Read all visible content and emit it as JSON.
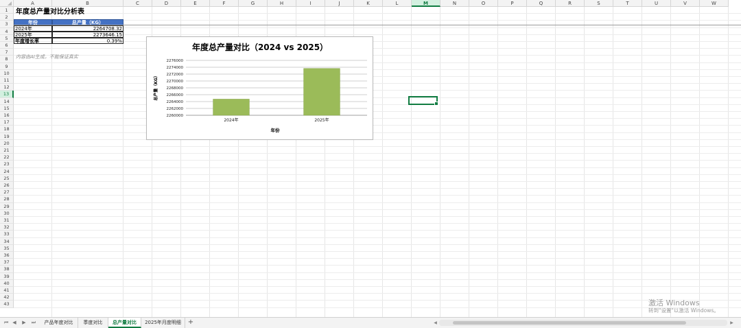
{
  "columns": [
    "A",
    "B",
    "C",
    "D",
    "E",
    "F",
    "G",
    "H",
    "I",
    "J",
    "K",
    "L",
    "M",
    "N",
    "O",
    "P",
    "Q",
    "R",
    "S",
    "T",
    "U",
    "V",
    "W"
  ],
  "active_column": "M",
  "active_row": 13,
  "row_count": 43,
  "cells": {
    "title": "年度总产量对比分析表",
    "header_year": "年份",
    "header_output": "总产量（KG）",
    "year_2024": "2024年",
    "value_2024": "2264708.32",
    "year_2025": "2025年",
    "value_2025": "2273646.15",
    "growth_label": "年度增长率",
    "growth_value": "0.39%",
    "ai_note": "内容由AI生成，不能保证真实"
  },
  "chart_data": {
    "type": "bar",
    "title": "年度总产量对比（2024 vs 2025）",
    "categories": [
      "2024年",
      "2025年"
    ],
    "values": [
      2264708.32,
      2273646.15
    ],
    "xlabel": "年份",
    "ylabel": "总产量（KG）",
    "ylim": [
      2260000,
      2276000
    ],
    "yticks": [
      2276000,
      2274000,
      2272000,
      2270000,
      2268000,
      2266000,
      2264000,
      2262000,
      2260000
    ],
    "grid": true,
    "legend": "none",
    "bar_color": "#9bbb59"
  },
  "tabs": [
    {
      "label": "产品年度对比",
      "active": false
    },
    {
      "label": "季度对比",
      "active": false
    },
    {
      "label": "总产量对比",
      "active": true
    },
    {
      "label": "2025年月度明细",
      "active": false
    }
  ],
  "tab_nav": {
    "first": "⏮",
    "prev": "◀",
    "next": "▶",
    "last": "⏭",
    "add": "+"
  },
  "watermark": {
    "line1": "激活 Windows",
    "line2": "转到\"设置\"以激活 Windows。"
  },
  "colors": {
    "accent": "#107c41",
    "header_fill": "#4472c4"
  }
}
